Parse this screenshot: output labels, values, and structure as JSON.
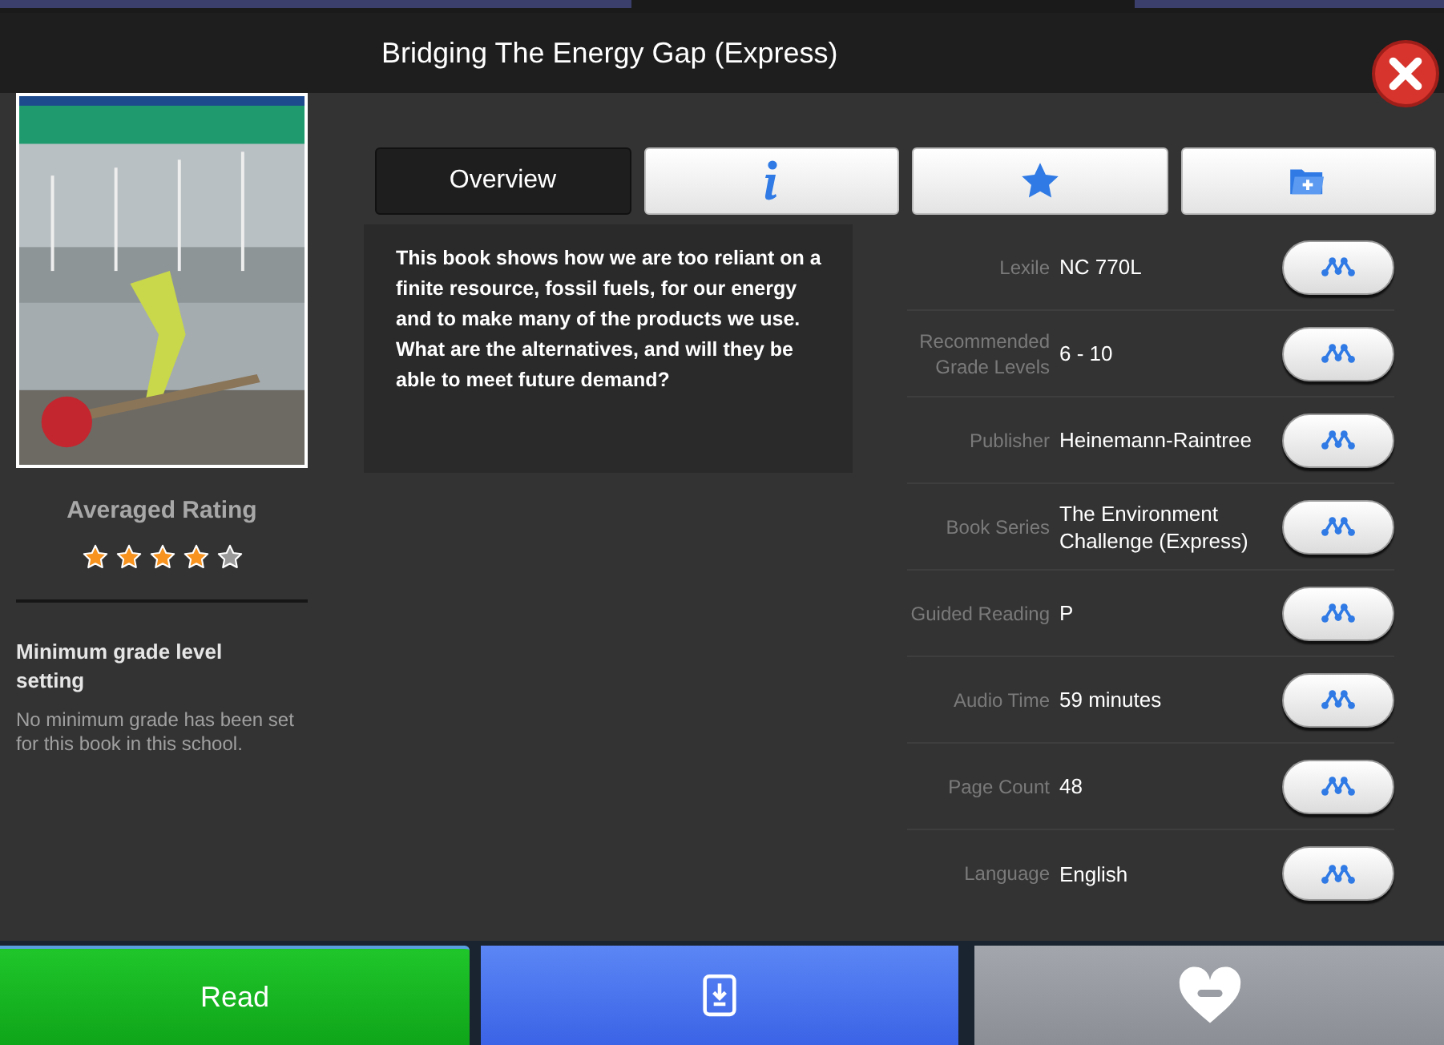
{
  "title": "Bridging The Energy Gap (Express)",
  "rating": {
    "label": "Averaged Rating",
    "stars": 4
  },
  "grade_setting": {
    "heading": "Minimum grade level setting",
    "text": "No minimum grade has been set for this book in this school."
  },
  "tabs": [
    {
      "kind": "text",
      "label": "Overview",
      "selected": true
    },
    {
      "kind": "info",
      "selected": false
    },
    {
      "kind": "star",
      "selected": false
    },
    {
      "kind": "folder",
      "selected": false
    }
  ],
  "description": "This book shows how we are too reliant on a finite resource, fossil fuels, for our energy and to make many of the products we use. What are the alternatives, and will they be able to meet future demand?",
  "details": [
    {
      "label": "Lexile",
      "value": "NC 770L"
    },
    {
      "label": "Recommended Grade Levels",
      "value": "6 - 10"
    },
    {
      "label": "Publisher",
      "value": "Heinemann-Raintree"
    },
    {
      "label": "Book Series",
      "value": "The Environment Challenge (Express)"
    },
    {
      "label": "Guided Reading",
      "value": "P"
    },
    {
      "label": "Audio Time",
      "value": "59 minutes"
    },
    {
      "label": "Page Count",
      "value": "48"
    },
    {
      "label": "Language",
      "value": "English"
    }
  ],
  "actions": [
    {
      "kind": "read",
      "label": "Read"
    },
    {
      "kind": "download"
    },
    {
      "kind": "unfavorite"
    }
  ]
}
